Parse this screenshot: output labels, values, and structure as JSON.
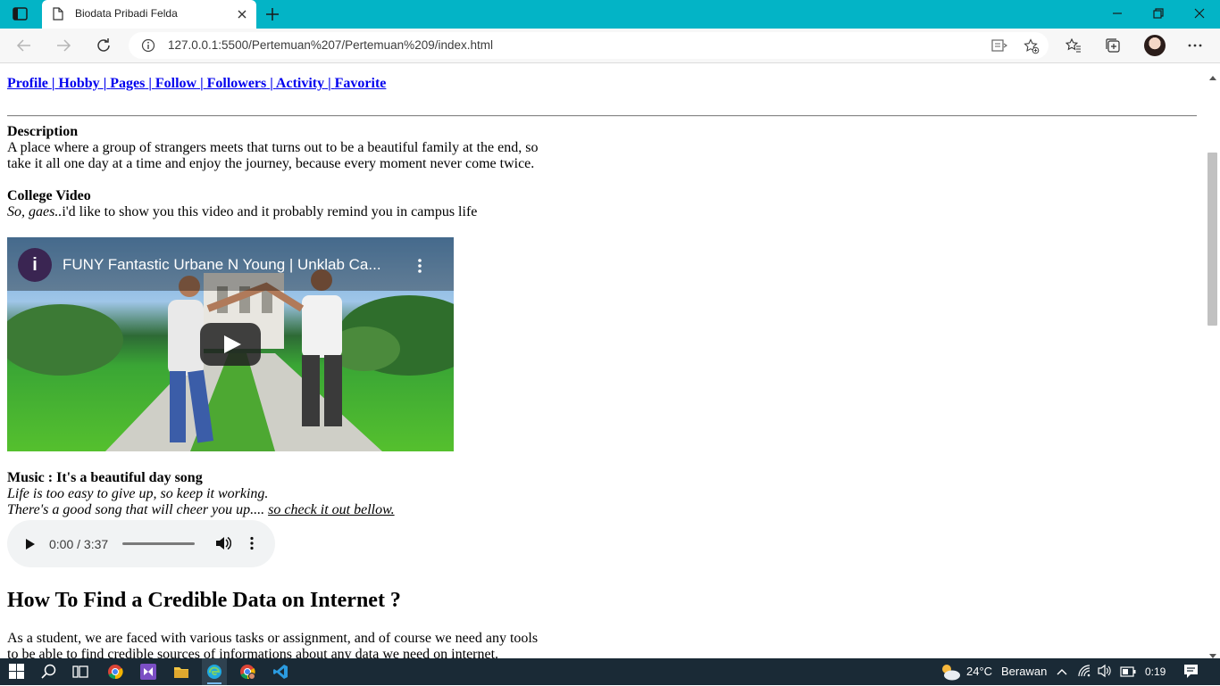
{
  "browser": {
    "tab_title": "Biodata Pribadi Felda",
    "url": "127.0.0.1:5500/Pertemuan%207/Pertemuan%209/index.html",
    "accent_color": "#03b4c6"
  },
  "icons": {
    "tab_actions": "tab-actions-icon",
    "tab_page": "document-icon",
    "tab_close": "close-icon",
    "new_tab": "plus-icon",
    "minimize": "minimize-icon",
    "restore": "restore-icon",
    "close_window": "close-icon",
    "back": "back-arrow-icon",
    "forward": "forward-arrow-icon",
    "refresh": "refresh-icon",
    "site_info": "info-icon",
    "immersive_reader": "immersive-reader-icon",
    "add_favorite": "star-plus-icon",
    "favorites": "favorites-icon",
    "collections": "collections-icon",
    "profile": "avatar",
    "more": "more-icon"
  },
  "nav": {
    "links": [
      "Profile",
      "Hobby",
      "Pages",
      "Follow",
      "Followers",
      "Activity",
      "Favorite"
    ],
    "separator": "|"
  },
  "description": {
    "heading": "Description",
    "text": "A place where a group of strangers meets that turns out to be a beautiful family at the end, so take it all one day at a time and enjoy the journey, because every moment never come twice."
  },
  "college_video": {
    "heading": "College Video",
    "intro_italic": "So, gaes..",
    "intro_rest": "i'd like to show you this video and it probably remind you in campus life",
    "video_title": "FUNY Fantastic Urbane N Young | Unklab Ca...",
    "channel_initial": "i"
  },
  "music": {
    "heading": "Music : It's a beautiful day song",
    "line1": "Life is too easy to give up, so keep it working.",
    "line2": "There's a good song that will cheer you up.... ",
    "link_text": "so check it out bellow.",
    "player_time": "0:00 / 3:37",
    "progress": 0
  },
  "article": {
    "heading": "How To Find a Credible Data on Internet ?",
    "text": "As a student, we are faced with various tasks or assignment, and of course we need any tools to be able to find credible sources of informations about any data we need on internet."
  },
  "taskbar": {
    "temperature": "24°C",
    "weather": "Berawan",
    "time": "0:19"
  }
}
